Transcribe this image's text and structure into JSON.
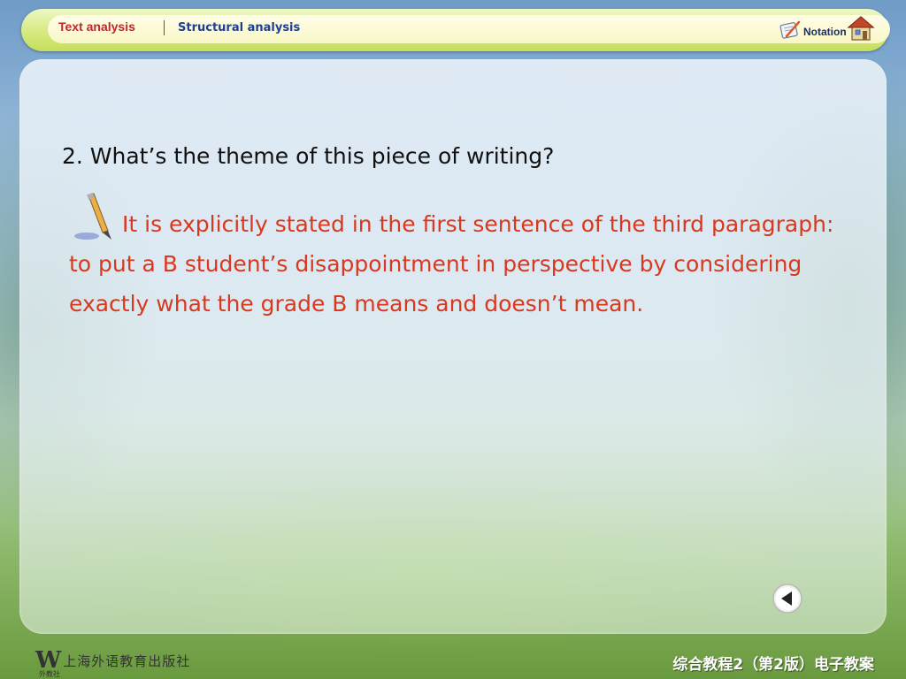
{
  "nav": {
    "tab_text_analysis": "Text analysis",
    "tab_structural_analysis": "Structural analysis",
    "notation_label": "Notation"
  },
  "content": {
    "question": "2. What’s the theme of this piece of writing?",
    "answer": "It is explicitly stated in the first sentence of the third paragraph: to put a B student’s disappointment in perspective by considering exactly what the grade B means and doesn’t mean."
  },
  "footer": {
    "publisher_mark": "W",
    "publisher_name": "上海外语教育出版社",
    "publisher_sub": "外教社",
    "course_title": "综合教程2（第2版）电子教案"
  },
  "colors": {
    "active_tab": "#c0262c",
    "inactive_tab": "#1f3f8f",
    "answer_text": "#d9381e"
  },
  "icons": [
    "notation-icon",
    "home-icon",
    "pen-icon",
    "back-arrow-icon"
  ]
}
